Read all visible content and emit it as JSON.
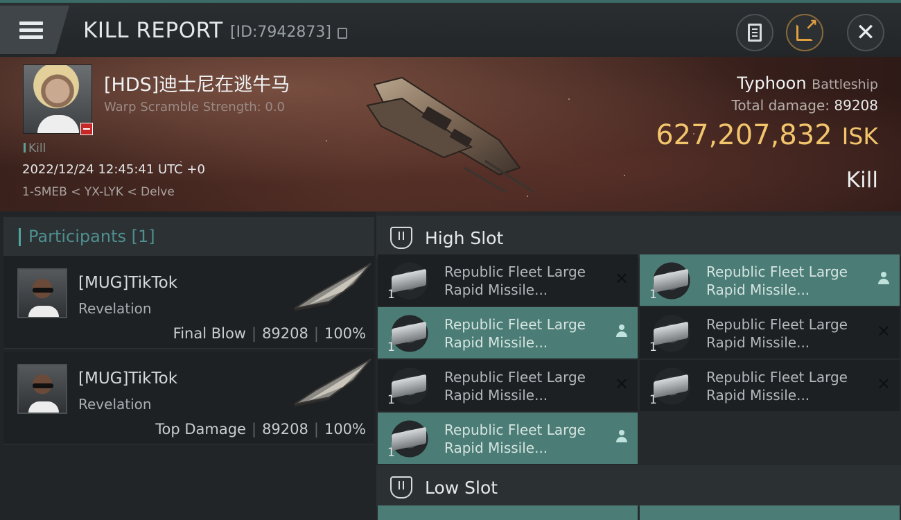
{
  "header": {
    "title": "KILL REPORT",
    "report_id": "[ID:7942873]"
  },
  "victim": {
    "name": "[HDS]迪士尼在逃牛马",
    "warp_scramble": "Warp Scramble Strength: 0.0",
    "tag": "Kill",
    "datetime": "2022/12/24 12:45:41 UTC +0",
    "location": "1-SMEB < YX-LYK < Delve",
    "ship_name": "Typhoon",
    "ship_class": "Battleship",
    "total_damage_label": "Total damage:",
    "total_damage": "89208",
    "isk_value": "627,207,832",
    "isk_unit": "ISK",
    "result": "Kill"
  },
  "participants": {
    "label": "Participants",
    "count": "[1]",
    "list": [
      {
        "name": "[MUG]TikTok",
        "ship": "Revelation",
        "role": "Final Blow",
        "damage": "89208",
        "percent": "100%"
      },
      {
        "name": "[MUG]TikTok",
        "ship": "Revelation",
        "role": "Top Damage",
        "damage": "89208",
        "percent": "100%"
      }
    ],
    "separator": "|"
  },
  "slots": {
    "high_label": "High Slot",
    "low_label": "Low Slot",
    "high": [
      {
        "line1": "Republic Fleet Large",
        "line2": "Rapid Missile...",
        "qty": "1",
        "status": "destroyed"
      },
      {
        "line1": "Republic Fleet Large",
        "line2": "Rapid Missile...",
        "qty": "1",
        "status": "dropped"
      },
      {
        "line1": "Republic Fleet Large",
        "line2": "Rapid Missile...",
        "qty": "1",
        "status": "dropped"
      },
      {
        "line1": "Republic Fleet Large",
        "line2": "Rapid Missile...",
        "qty": "1",
        "status": "destroyed"
      },
      {
        "line1": "Republic Fleet Large",
        "line2": "Rapid Missile...",
        "qty": "1",
        "status": "destroyed"
      },
      {
        "line1": "Republic Fleet Large",
        "line2": "Rapid Missile...",
        "qty": "1",
        "status": "destroyed"
      },
      {
        "line1": "Republic Fleet Large",
        "line2": "Rapid Missile...",
        "qty": "1",
        "status": "dropped"
      }
    ]
  },
  "colors": {
    "accent_teal": "#4b7d76",
    "isk_gold": "#f2c56c"
  }
}
